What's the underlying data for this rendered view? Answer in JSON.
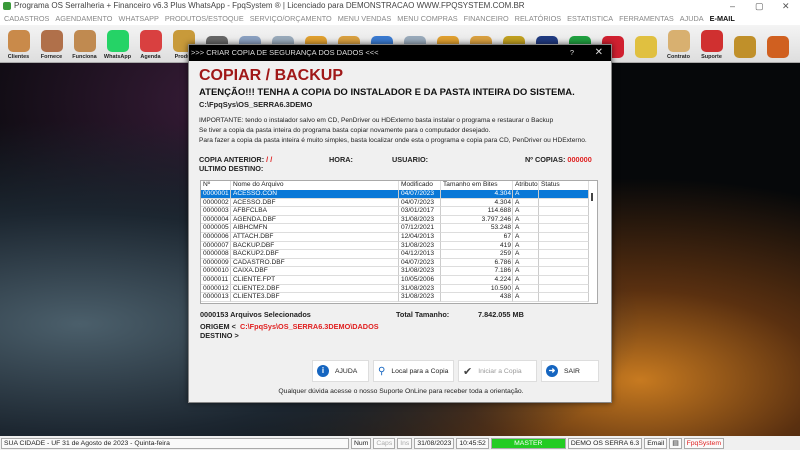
{
  "window": {
    "title": "Programa OS Serralheria + Financeiro v6.3 Plus WhatsApp - FpqSystem ® | Licenciado para  DEMONSTRACAO WWW.FPQSYSTEM.COM.BR",
    "minimize": "–",
    "maximize": "▢",
    "close": "✕"
  },
  "menu": [
    "CADASTROS",
    "AGENDAMENTO",
    "WHATSAPP",
    "PRODUTOS/ESTOQUE",
    "SERVIÇO/ORÇAMENTO",
    "MENU VENDAS",
    "MENU COMPRAS",
    "FINANCEIRO",
    "RELATÓRIOS",
    "ESTATISTICA",
    "FERRAMENTAS",
    "AJUDA",
    "E-MAIL"
  ],
  "toolbar": [
    {
      "label": "Clientes",
      "color": "#c98a4a"
    },
    {
      "label": "Fornece",
      "color": "#b0704a"
    },
    {
      "label": "Funciona",
      "color": "#c08a50"
    },
    {
      "label": "WhatsApp",
      "color": "#25d366"
    },
    {
      "label": "Agenda",
      "color": "#d94040"
    },
    {
      "label": "Produt",
      "color": "#c89a3a"
    },
    {
      "label": "",
      "color": "#666"
    },
    {
      "label": "",
      "color": "#8aa0c0"
    },
    {
      "label": "",
      "color": "#9ab"
    },
    {
      "label": "",
      "color": "#e0a030"
    },
    {
      "label": "",
      "color": "#d9a040"
    },
    {
      "label": "",
      "color": "#3a7ad0"
    },
    {
      "label": "",
      "color": "#9ab"
    },
    {
      "label": "",
      "color": "#e0a030"
    },
    {
      "label": "",
      "color": "#d9a040"
    },
    {
      "label": "",
      "color": "#c0a020"
    },
    {
      "label": "",
      "color": "#203a80"
    },
    {
      "label": "",
      "color": "#20a040"
    },
    {
      "label": "",
      "color": "#d02030"
    },
    {
      "label": "",
      "color": "#e0c040"
    },
    {
      "label": "Contrato",
      "color": "#d8b070"
    },
    {
      "label": "Suporte",
      "color": "#d03030"
    },
    {
      "label": "",
      "color": "#c0902a"
    },
    {
      "label": "",
      "color": "#d06020"
    }
  ],
  "dialog": {
    "title": ">>> CRIAR COPIA DE SEGURANÇA DOS DADOS <<<",
    "help": "?",
    "close": "✕",
    "heading": "COPIAR / BACKUP",
    "warning": "ATENÇÃO!!!  TENHA A COPIA DO  INSTALADOR  E  DA PASTA INTEIRA DO  SISTEMA.",
    "path": "C:\\FpqSys\\OS_SERRA6.3DEMO",
    "info": [
      "IMPORTANTE: tendo o instalador salvo em CD, PenDriver ou HDExterno basta instalar o programa e restaurar o Backup",
      "Se tiver a copia da pasta inteira do programa basta copiar novamente para o computador desejado.",
      "Para fazer a copia da pasta inteira é muito simples, basta localizar onde esta o programa e copia para CD, PenDriver ou HDExterno."
    ],
    "copia_anterior_label": "COPIA ANTERIOR:",
    "copia_anterior": "/ /",
    "hora_label": "HORA:",
    "usuario_label": "USUARIO:",
    "ncopias_label": "Nº COPIAS:",
    "ncopias": "000000",
    "ultimo_destino_label": "ULTIMO DESTINO:",
    "columns": [
      "Nº",
      "Nome do Arquivo",
      "Modificado",
      "Tamanho em Bites",
      "Atributo",
      "Status"
    ],
    "rows": [
      [
        "0000001",
        "ACESSO.CON",
        "04/07/2023",
        "4.304",
        "A",
        ""
      ],
      [
        "0000002",
        "ACESSO.DBF",
        "04/07/2023",
        "4.304",
        "A",
        ""
      ],
      [
        "0000003",
        "AFBFCLBA",
        "03/01/2017",
        "114.688",
        "A",
        ""
      ],
      [
        "0000004",
        "AGENDA.DBF",
        "31/08/2023",
        "3.797.246",
        "A",
        ""
      ],
      [
        "0000005",
        "AIBHCMFN",
        "07/12/2021",
        "53.248",
        "A",
        ""
      ],
      [
        "0000006",
        "ATTACH.DBF",
        "12/04/2013",
        "67",
        "A",
        ""
      ],
      [
        "0000007",
        "BACKUP.DBF",
        "31/08/2023",
        "419",
        "A",
        ""
      ],
      [
        "0000008",
        "BACKUP2.DBF",
        "04/12/2013",
        "259",
        "A",
        ""
      ],
      [
        "0000009",
        "CADASTRO.DBF",
        "04/07/2023",
        "6.786",
        "A",
        ""
      ],
      [
        "0000010",
        "CAIXA.DBF",
        "31/08/2023",
        "7.186",
        "A",
        ""
      ],
      [
        "0000011",
        "CLIENTE.FPT",
        "10/05/2006",
        "4.224",
        "A",
        ""
      ],
      [
        "0000012",
        "CLIENTE2.DBF",
        "31/08/2023",
        "10.590",
        "A",
        ""
      ],
      [
        "0000013",
        "CLIENTE3.DBF",
        "31/08/2023",
        "438",
        "A",
        ""
      ]
    ],
    "selected_count": "0000153 Arquivos Selecionados",
    "total_label": "Total Tamanho:",
    "total": "7.842.055 MB",
    "origem_label": "ORIGEM  <",
    "origem": "C:\\FpqSys\\OS_SERRA6.3DEMO\\DADOS",
    "destino_label": "DESTINO >",
    "buttons": {
      "ajuda": "AJUDA",
      "local": "Local para a Copia",
      "iniciar": "Iniciar a Copia",
      "sair": "SAIR"
    },
    "footer": "Qualquer dúvida acesse o nosso Suporte OnLine para receber toda a orientação."
  },
  "status": {
    "city": "SUA CIDADE - UF 31 de Agosto de 2023 - Quinta-feira",
    "num": "Num",
    "caps": "Caps",
    "ins": "Ins",
    "date": "31/08/2023",
    "time": "10:45:52",
    "user": "MASTER",
    "version": "DEMO OS SERRA 6.3",
    "email": "Email",
    "brand": "FpqSystem"
  }
}
